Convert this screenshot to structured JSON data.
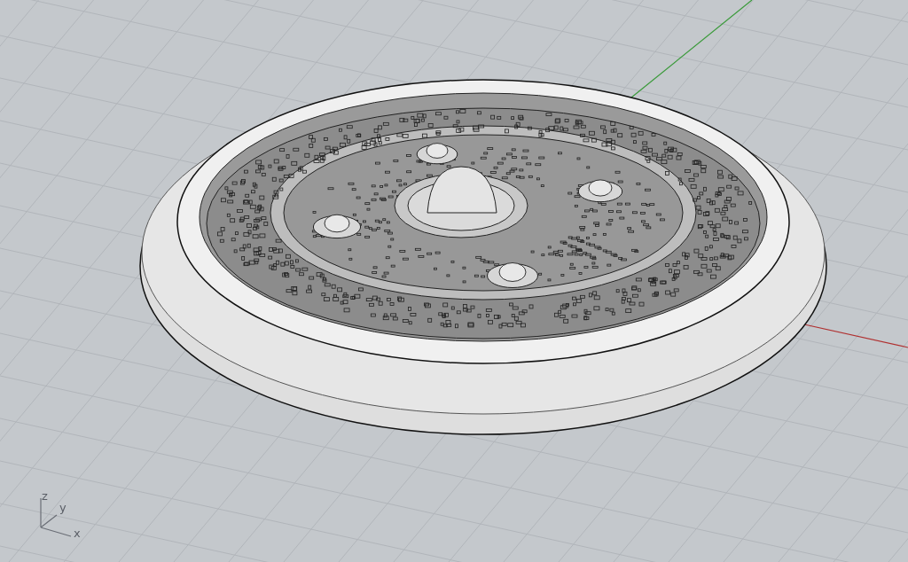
{
  "viewport": {
    "axis_labels": [
      "z",
      "y",
      "x"
    ]
  }
}
